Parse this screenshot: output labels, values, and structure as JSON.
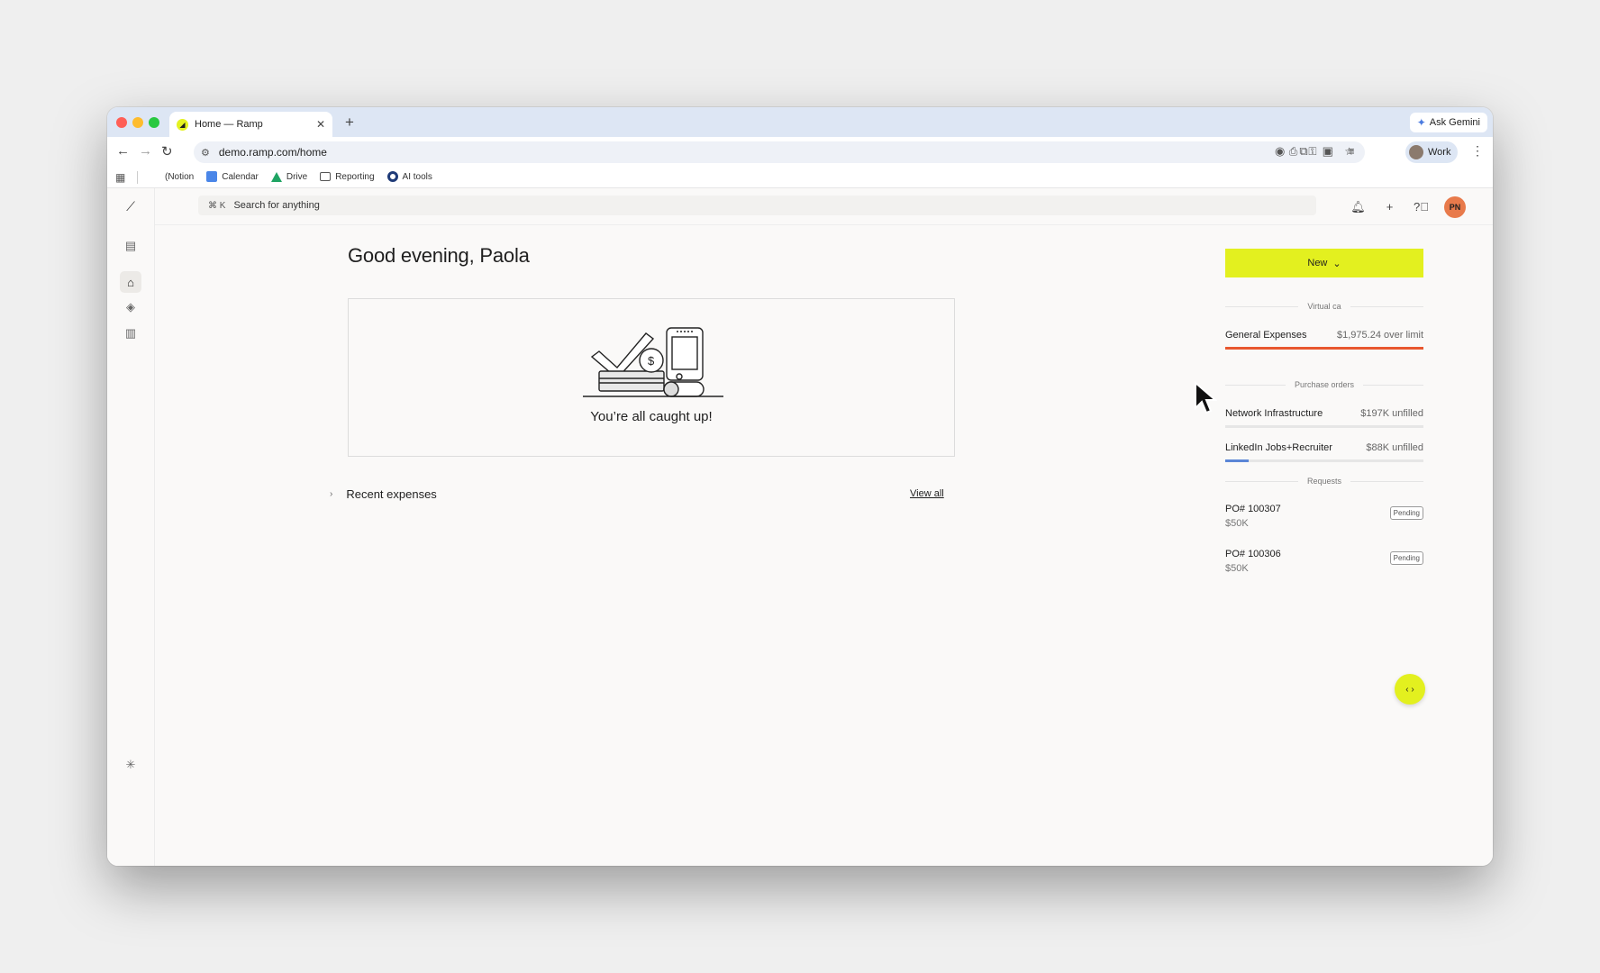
{
  "browser": {
    "tab_title": "Home — Ramp",
    "new_tab": "+",
    "tab_close": "✕",
    "gemini_label": "Ask Gemini",
    "url": "demo.ramp.com/home",
    "profile_label": "Work",
    "bookmarks": [
      "(Notion",
      "Calendar",
      "Drive",
      "Reporting",
      "AI tools"
    ]
  },
  "app": {
    "search_shortcut": "⌘  K",
    "search_placeholder": "Search for anything",
    "avatar_initials": "PN",
    "greeting": "Good evening, Paola",
    "caught_up": "You’re all caught up!",
    "recent_expenses": "Recent expenses",
    "view_all": "View all"
  },
  "right_panel": {
    "new_button": "New",
    "virtual_cards_label": "Virtual ca",
    "card_name": "General Expenses",
    "card_status": "$1,975.24 over limit",
    "card_fill": 1.0,
    "purchase_orders_label": "Purchase orders",
    "purchase_orders": [
      {
        "name": "Network Infrastructure",
        "value": "$197K unfilled",
        "fill": 0.0
      },
      {
        "name": "LinkedIn Jobs+Recruiter",
        "value": "$88K unfilled",
        "fill": 0.12
      }
    ],
    "requests_label": "Requests",
    "requests": [
      {
        "title": "PO# 100307",
        "amount": "$50K",
        "status": "Pending"
      },
      {
        "title": "PO# 100306",
        "amount": "$50K",
        "status": "Pending"
      }
    ]
  },
  "colors": {
    "accent": "#e3f01f",
    "over_limit": "#e8572e",
    "progress": "#5b86d6"
  }
}
